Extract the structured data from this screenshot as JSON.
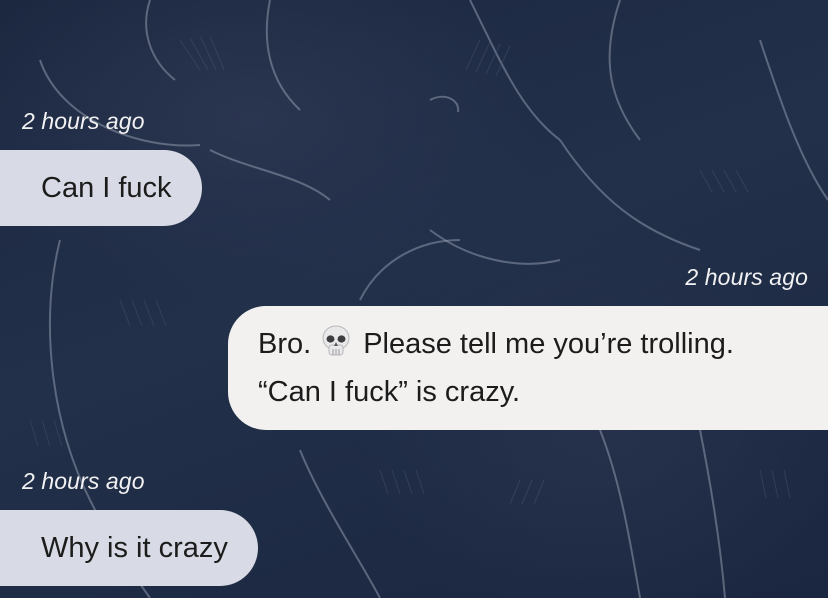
{
  "chat": {
    "messages": [
      {
        "sender": "user",
        "timestamp": "2 hours ago",
        "text": "Can I fuck"
      },
      {
        "sender": "bot",
        "timestamp": "2 hours ago",
        "line1_prefix": "Bro.",
        "emoji": "skull-emoji",
        "line1_suffix": "Please tell me you’re trolling.",
        "line2": "“Can I fuck” is crazy."
      },
      {
        "sender": "user",
        "timestamp": "2 hours ago",
        "text": "Why is it crazy"
      }
    ]
  },
  "colors": {
    "background": "#1f2a41",
    "incoming_bubble": "#d8dbe5",
    "outgoing_bubble": "#f2f1f0",
    "timestamp_text": "#f2f2f2"
  }
}
